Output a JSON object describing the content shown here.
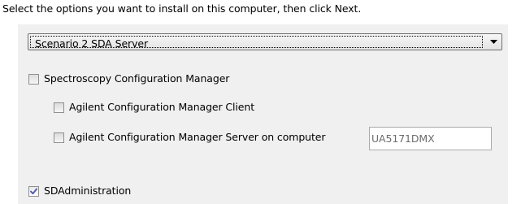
{
  "instruction": "Select the options you want to install on this computer, then click Next.",
  "scenario": {
    "selected": "Scenario 2 SDA Server",
    "arrow_icon": "dropdown-arrow-icon"
  },
  "options": {
    "spectroscopy_config_manager": {
      "label": "Spectroscopy Configuration Manager",
      "checked": false
    },
    "client": {
      "label": "Agilent Configuration Manager Client",
      "checked": false
    },
    "server": {
      "label": "Agilent Configuration Manager Server on computer",
      "checked": false,
      "computer_name": "UA5171DMX"
    },
    "sdadministration": {
      "label": "SDAdministration",
      "checked": true
    }
  },
  "colors": {
    "panel_background": "#f0f0f0",
    "check_mark": "#4a5bb0",
    "disabled_text": "#6d6d6d"
  }
}
